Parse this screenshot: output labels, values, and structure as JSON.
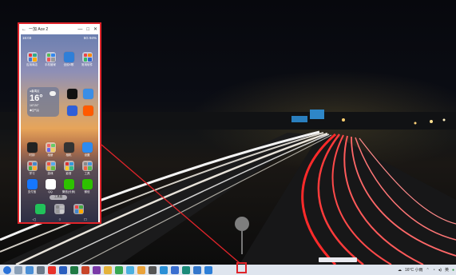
{
  "phone_window": {
    "title": "一加 Ace 2",
    "controls": [
      "—",
      "□",
      "✕"
    ],
    "status_time": "16:03",
    "status_right": "5G 94%",
    "weather": {
      "city": "●番禺区",
      "temp": "16°",
      "condition": "16°/20°",
      "aqi": "◆空气良"
    },
    "dock_label": "工具箱",
    "apps": [
      {
        "label": "应用商店"
      },
      {
        "label": "手机管家"
      },
      {
        "label": "全民K歌"
      },
      {
        "label": "常用软件"
      },
      {
        "label": "抖音"
      },
      {
        "label": "闹钟"
      },
      {
        "label": "百度"
      },
      {
        "label": "淘宝"
      },
      {
        "label": "时钟"
      },
      {
        "label": "相册"
      },
      {
        "label": "相机"
      },
      {
        "label": "设置"
      },
      {
        "label": "学习"
      },
      {
        "label": "游戏"
      },
      {
        "label": "影音"
      },
      {
        "label": "工具"
      },
      {
        "label": "支付宝"
      },
      {
        "label": "QQ"
      },
      {
        "label": "微信(分身)"
      },
      {
        "label": "微信"
      }
    ],
    "nav": [
      "◁",
      "○",
      "□"
    ]
  },
  "taskbar": {
    "weather": "16°C 小雨",
    "language": "英",
    "icons": [
      "start-icon",
      "search-icon",
      "mail-icon",
      "files-icon",
      "wps-icon",
      "word-icon",
      "excel-icon",
      "ppt-icon",
      "onenote-icon",
      "folder-icon",
      "browser-icon",
      "maps-icon",
      "photos-icon",
      "settings-icon",
      "tool-icon",
      "chat-icon",
      "edge-icon",
      "camera-icon",
      "phone-link-icon"
    ]
  },
  "colors": {
    "highlight": "#e0242a",
    "taskbar": "#dfe5ee"
  }
}
